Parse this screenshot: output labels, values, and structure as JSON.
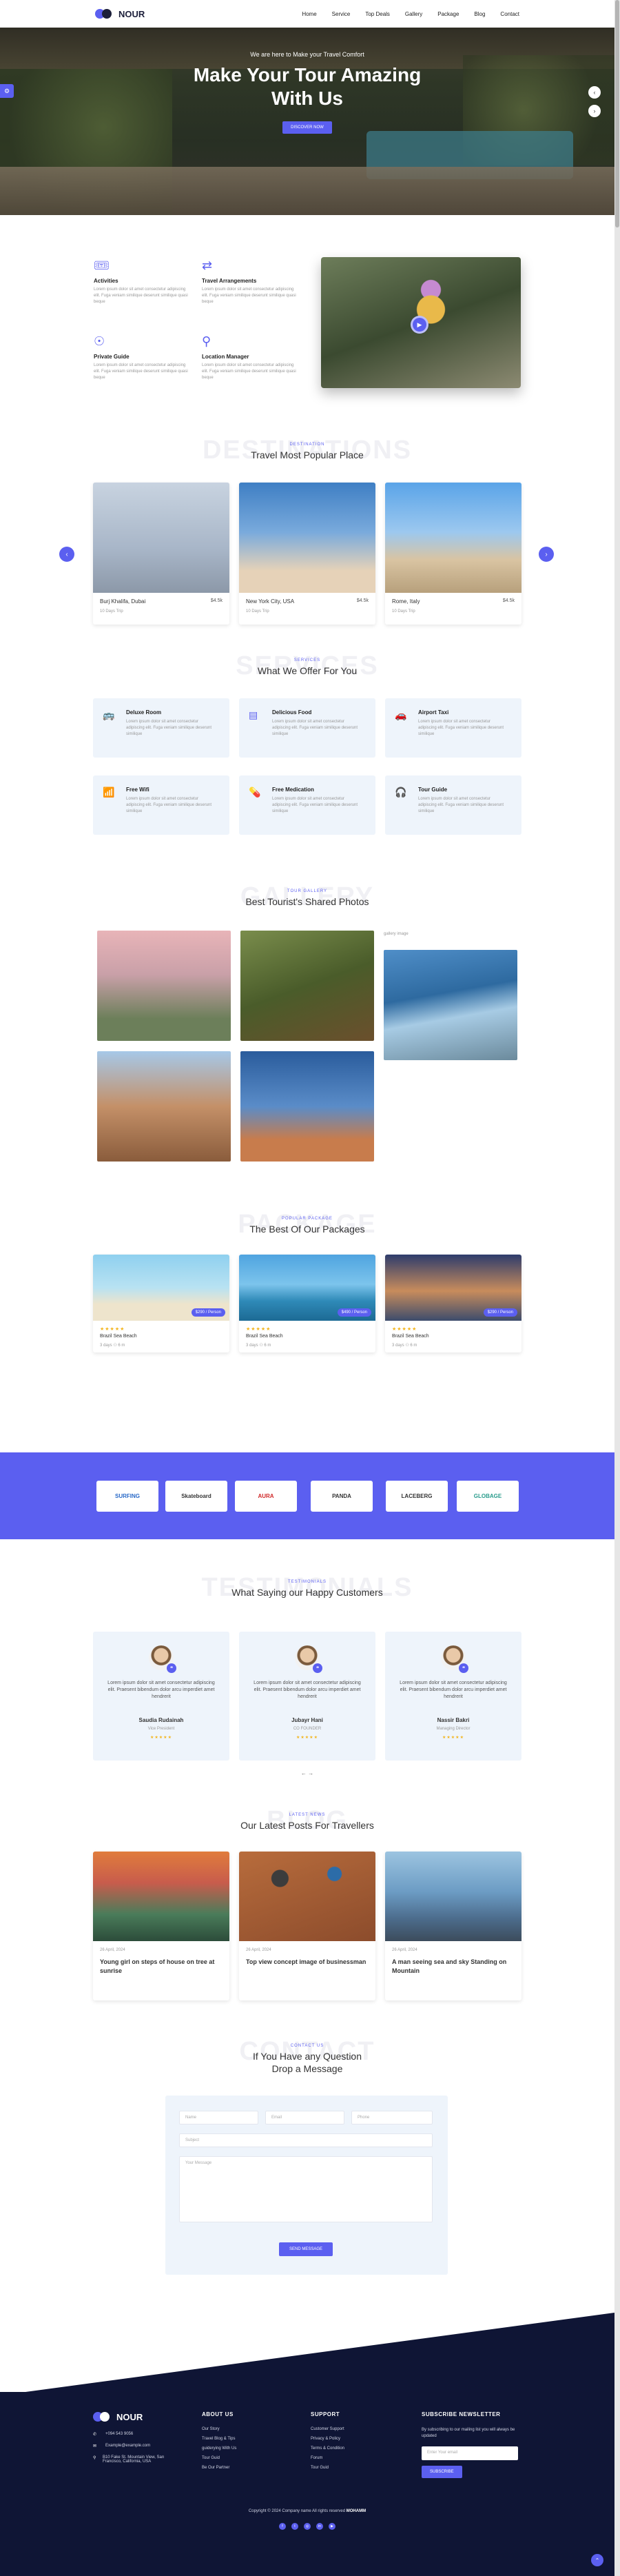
{
  "nav": {
    "brand": "NOUR",
    "items": [
      "Home",
      "Service",
      "Top Deals",
      "Gallery",
      "Package",
      "Blog",
      "Contact"
    ]
  },
  "hero": {
    "subtitle": "We are here to Make your Travel Comfort",
    "title": "Make Your Tour Amazing With Us",
    "button": "DISCOVER NOW"
  },
  "about": {
    "features": [
      {
        "icon": "activities-icon",
        "title": "Activities",
        "text": "Lorem ipsum dolor sit amet consectetur adipiscing elit. Fuga veniam similique deserunt similique quasi beque"
      },
      {
        "icon": "travel-arrangements-icon",
        "title": "Travel Arrangements",
        "text": "Lorem ipsum dolor sit amet consectetur adipiscing elit. Fuga veniam similique deserunt similique quasi beque"
      },
      {
        "icon": "private-guide-icon",
        "title": "Private Guide",
        "text": "Lorem ipsum dolor sit amet consectetur adipiscing elit. Fuga veniam similique deserunt similique quasi beque"
      },
      {
        "icon": "location-pin-icon",
        "title": "Location Manager",
        "text": "Lorem ipsum dolor sit amet consectetur adipiscing elit. Fuga veniam similique deserunt similique quasi beque"
      }
    ]
  },
  "destinations": {
    "ghost": "DESTINATIONS",
    "tag": "DESTINATION",
    "title": "Travel Most Popular Place",
    "cards": [
      {
        "name": "Burj Khalifa, Dubai",
        "price": "$4.5k",
        "days": "10 Days Trip"
      },
      {
        "name": "New York City, USA",
        "price": "$4.5k",
        "days": "10 Days Trip"
      },
      {
        "name": "Rome, Italy",
        "price": "$4.5k",
        "days": "10 Days Trip"
      }
    ]
  },
  "services": {
    "ghost": "SERVICES",
    "tag": "SERVICES",
    "title": "What We Offer For You",
    "items": [
      {
        "icon": "bus-icon",
        "title": "Deluxe Room",
        "text": "Lorem ipsum dolor sit amet consectetur adipiscing elit. Fuga veniam similique deserunt similique"
      },
      {
        "icon": "food-icon",
        "title": "Delicious Food",
        "text": "Lorem ipsum dolor sit amet consectetur adipiscing elit. Fuga veniam similique deserunt similique"
      },
      {
        "icon": "car-icon",
        "title": "Airport Taxi",
        "text": "Lorem ipsum dolor sit amet consectetur adipiscing elit. Fuga veniam similique deserunt similique"
      },
      {
        "icon": "wifi-icon",
        "title": "Free Wifi",
        "text": "Lorem ipsum dolor sit amet consectetur adipiscing elit. Fuga veniam similique deserunt similique"
      },
      {
        "icon": "medication-icon",
        "title": "Free Medication",
        "text": "Lorem ipsum dolor sit amet consectetur adipiscing elit. Fuga veniam similique deserunt similique"
      },
      {
        "icon": "headset-icon",
        "title": "Tour Guide",
        "text": "Lorem ipsum dolor sit amet consectetur adipiscing elit. Fuga veniam similique deserunt similique"
      }
    ]
  },
  "gallery": {
    "ghost": "GALLERY",
    "tag": "TOUR GALLERY",
    "title": "Best Tourist's Shared Photos",
    "broken_label": "gallery image"
  },
  "packages": {
    "ghost": "PACKAGE",
    "tag": "POPULAR PACKAGE",
    "title": "The Best Of Our Packages",
    "items": [
      {
        "badge": "$290 / Person",
        "stars": "★★★★★",
        "name": "Brazil Sea Beach",
        "meta": "3 days  ⚇ 6 m"
      },
      {
        "badge": "$490 / Person",
        "stars": "★★★★★",
        "name": "Brazil Sea Beach",
        "meta": "3 days  ⚇ 6 m"
      },
      {
        "badge": "$290 / Person",
        "stars": "★★★★★",
        "name": "Brazil Sea Beach",
        "meta": "3 days  ⚇ 6 m"
      }
    ]
  },
  "partners": [
    "SURFING",
    "Skateboard",
    "AURA",
    "PANDA",
    "LACEBERG",
    "GLOBAGE"
  ],
  "testimonials": {
    "ghost": "TESTIMONIALS",
    "tag": "TESTIMONIALS",
    "title": "What Saying our Happy Customers",
    "items": [
      {
        "text": "Lorem ipsum dolor sit amet consectetur adipiscing elit. Praesent bibendum dolor arcu imperdiet amet hendrerit",
        "name": "Saudia Rudainah",
        "role": "Vice President",
        "stars": "★★★★★"
      },
      {
        "text": "Lorem ipsum dolor sit amet consectetur adipiscing elit. Praesent bibendum dolor arcu imperdiet amet hendrerit",
        "name": "Jubayr Hani",
        "role": "CO FOUNDER",
        "stars": "★★★★★"
      },
      {
        "text": "Lorem ipsum dolor sit amet consectetur adipiscing elit. Praesent bibendum dolor arcu imperdiet amet hendrerit",
        "name": "Nassir Bakri",
        "role": "Managing Director",
        "stars": "★★★★★"
      }
    ],
    "pager": "← →"
  },
  "blog": {
    "ghost": "BLOG",
    "tag": "LATEST NEWS",
    "title": "Our Latest Posts For Travellers",
    "posts": [
      {
        "date": "26 April, 2024",
        "title": "Young girl on steps of house on tree at sunrise"
      },
      {
        "date": "26 April, 2024",
        "title": "Top view concept image of businessman"
      },
      {
        "date": "26 April, 2024",
        "title": "A man seeing sea and sky Standing on Mountain"
      }
    ]
  },
  "contact": {
    "ghost": "CONTACT",
    "tag": "CONTACT US",
    "title1": "If You Have any Question",
    "title2": "Drop a Message",
    "name_ph": "Name",
    "email_ph": "Email",
    "phone_ph": "Phone",
    "subject_ph": "Subject",
    "message_ph": "Your Message",
    "button": "SEND MESSAGE"
  },
  "footer": {
    "brand": "NOUR",
    "phone": "+094 543 9056",
    "email": "Example@example.com",
    "address": "B10 Fake St. Mountain View, San Francisco, California, USA",
    "about_title": "ABOUT US",
    "about_links": [
      "Our Story",
      "Travel Blog & Tips",
      "guiderying With Us",
      "Tour Guid",
      "Be Our Partner"
    ],
    "support_title": "SUPPORT",
    "support_links": [
      "Customer Support",
      "Privacy & Policy",
      "Terms & Condition",
      "Forum",
      "Tour Guid"
    ],
    "news_title": "SUBSCRIBE NEWSLETTER",
    "news_text": "By subscribing to our mailing list you will always be updated",
    "news_ph": "Enter Your email",
    "news_btn": "SUBSCRIBE",
    "copyright": "Copyright © 2024 Company name All rights reserved",
    "copyright_brand": "MOHAMM"
  },
  "colors": {
    "accent": "#5b5ff0",
    "footer_bg": "#0f1535"
  }
}
